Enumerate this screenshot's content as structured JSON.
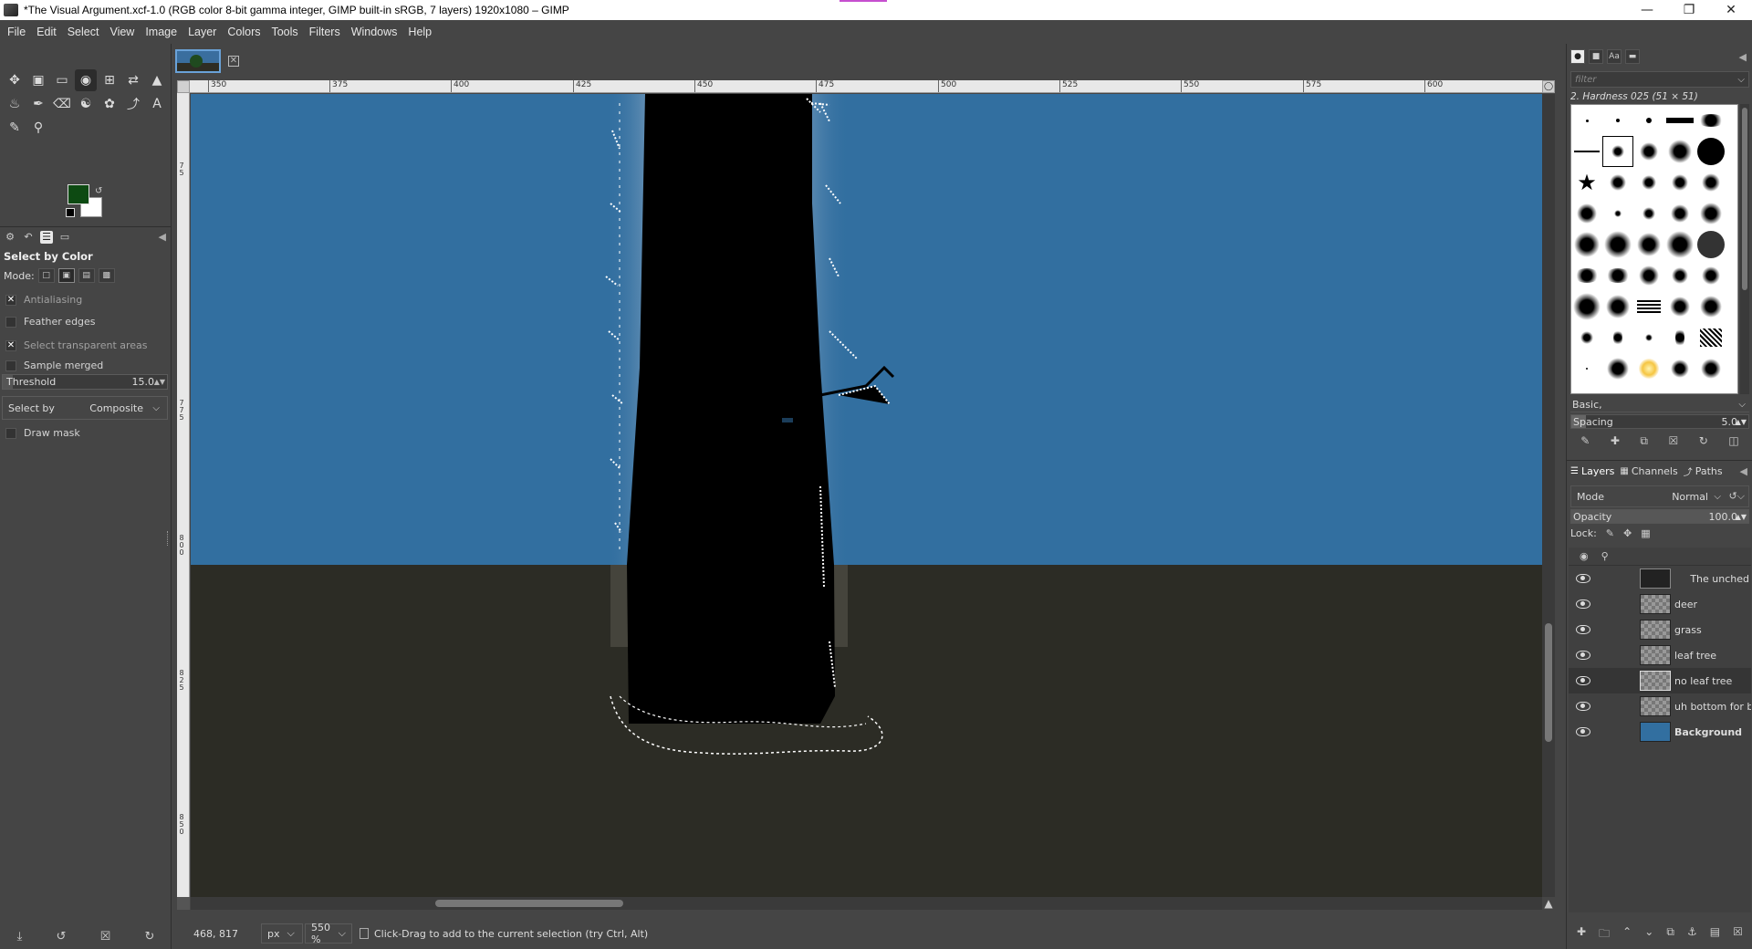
{
  "window": {
    "title": "*The Visual Argument.xcf-1.0 (RGB color 8-bit gamma integer, GIMP built-in sRGB, 7 layers) 1920x1080 – GIMP",
    "controls": [
      "minimize",
      "maximize",
      "close"
    ]
  },
  "menu": [
    "File",
    "Edit",
    "Select",
    "View",
    "Image",
    "Layer",
    "Colors",
    "Tools",
    "Filters",
    "Windows",
    "Help"
  ],
  "colors": {
    "foreground": "#0d4a12",
    "background": "#ffffff",
    "sky": "#326fa0",
    "ground": "#2c2c25"
  },
  "tool_options": {
    "title": "Select by Color",
    "mode_label": "Mode:",
    "antialiasing": {
      "label": "Antialiasing",
      "checked": true
    },
    "feather": {
      "label": "Feather edges",
      "checked": false
    },
    "transparent": {
      "label": "Select transparent areas",
      "checked": true
    },
    "sample_merged": {
      "label": "Sample merged",
      "checked": false
    },
    "threshold": {
      "label": "Threshold",
      "value": "15.0"
    },
    "select_by": {
      "label": "Select by",
      "value": "Composite"
    },
    "draw_mask": {
      "label": "Draw mask",
      "checked": false
    }
  },
  "rulers": {
    "h": [
      "350",
      "375",
      "400",
      "425",
      "450",
      "475",
      "500",
      "525",
      "550",
      "575",
      "600"
    ],
    "v": [
      [
        "7",
        "5"
      ],
      [
        "7",
        "7",
        "5"
      ],
      [
        "8",
        "0",
        "0"
      ],
      [
        "8",
        "2",
        "5"
      ],
      [
        "8",
        "5",
        "0"
      ]
    ]
  },
  "status": {
    "coords": "468, 817",
    "unit": "px",
    "zoom": "550 %",
    "message": "Click-Drag to add to the current selection (try Ctrl, Alt)"
  },
  "brushes": {
    "filter_placeholder": "filter",
    "current": "2. Hardness 025 (51 × 51)",
    "preset": "Basic,",
    "spacing": {
      "label": "Spacing",
      "value": "5.0"
    }
  },
  "layers_panel": {
    "tabs": [
      "Layers",
      "Channels",
      "Paths"
    ],
    "mode": {
      "label": "Mode",
      "value": "Normal"
    },
    "opacity": {
      "label": "Opacity",
      "value": "100.0"
    },
    "lock_label": "Lock:",
    "layers": [
      {
        "name": "The unched",
        "visible": true,
        "bold": false
      },
      {
        "name": "deer",
        "visible": true,
        "bold": false
      },
      {
        "name": "grass",
        "visible": true,
        "bold": false
      },
      {
        "name": "leaf tree",
        "visible": true,
        "bold": false
      },
      {
        "name": "no leaf tree",
        "visible": true,
        "bold": false,
        "selected": true
      },
      {
        "name": "uh bottom for ba",
        "visible": true,
        "bold": false
      },
      {
        "name": "Background",
        "visible": true,
        "bold": true
      }
    ]
  }
}
